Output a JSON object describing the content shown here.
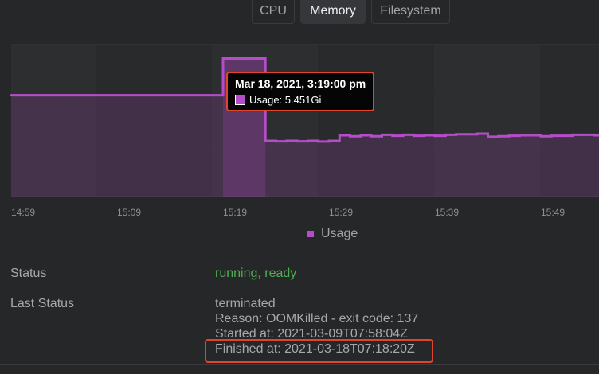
{
  "tabs": [
    {
      "label": "CPU",
      "active": false
    },
    {
      "label": "Memory",
      "active": true
    },
    {
      "label": "Filesystem",
      "active": false
    }
  ],
  "colors": {
    "series": "#b54cc9",
    "highlight": "#e0442a",
    "status_ok": "#4caf50",
    "background": "#262728"
  },
  "tooltip": {
    "title": "Mar 18, 2021, 3:19:00 pm",
    "value_text": "Usage: 5.451Gi"
  },
  "legend": {
    "label": "Usage"
  },
  "chart_data": {
    "type": "area",
    "series": [
      {
        "name": "Usage",
        "unit": "Gi",
        "x": [
          "14:59",
          "15:05",
          "15:10",
          "15:15",
          "15:19",
          "15:20",
          "15:21",
          "15:22",
          "15:23",
          "15:24",
          "15:25",
          "15:26",
          "15:27",
          "15:28",
          "15:29",
          "15:30",
          "15:31",
          "15:32",
          "15:33",
          "15:34",
          "15:35",
          "15:36",
          "15:37",
          "15:38",
          "15:39",
          "15:40",
          "15:41",
          "15:42",
          "15:43",
          "15:44",
          "15:45",
          "15:46",
          "15:47",
          "15:48",
          "15:49",
          "15:50",
          "15:51",
          "15:52",
          "15:53",
          "15:54",
          "15:55",
          "15:56"
        ],
        "values": [
          4.0,
          4.0,
          4.0,
          4.0,
          5.451,
          5.451,
          5.451,
          5.451,
          2.2,
          2.18,
          2.2,
          2.18,
          2.2,
          2.17,
          2.2,
          2.42,
          2.38,
          2.42,
          2.38,
          2.44,
          2.4,
          2.44,
          2.4,
          2.42,
          2.4,
          2.44,
          2.46,
          2.46,
          2.48,
          2.36,
          2.38,
          2.4,
          2.42,
          2.42,
          2.38,
          2.4,
          2.4,
          2.44,
          2.44,
          2.42,
          2.44,
          2.44
        ]
      }
    ],
    "x_ticks": [
      "14:59",
      "15:09",
      "15:19",
      "15:29",
      "15:39",
      "15:49"
    ],
    "ylim": [
      0,
      6
    ],
    "grid": true,
    "legend_position": "bottom-center"
  },
  "details": {
    "status_label": "Status",
    "status_value": "running, ready",
    "last_status_label": "Last Status",
    "last_status_state": "terminated",
    "last_status_reason": "Reason: OOMKilled - exit code: 137",
    "last_status_started": "Started at: 2021-03-09T07:58:04Z",
    "last_status_finished": "Finished at: 2021-03-18T07:18:20Z"
  }
}
